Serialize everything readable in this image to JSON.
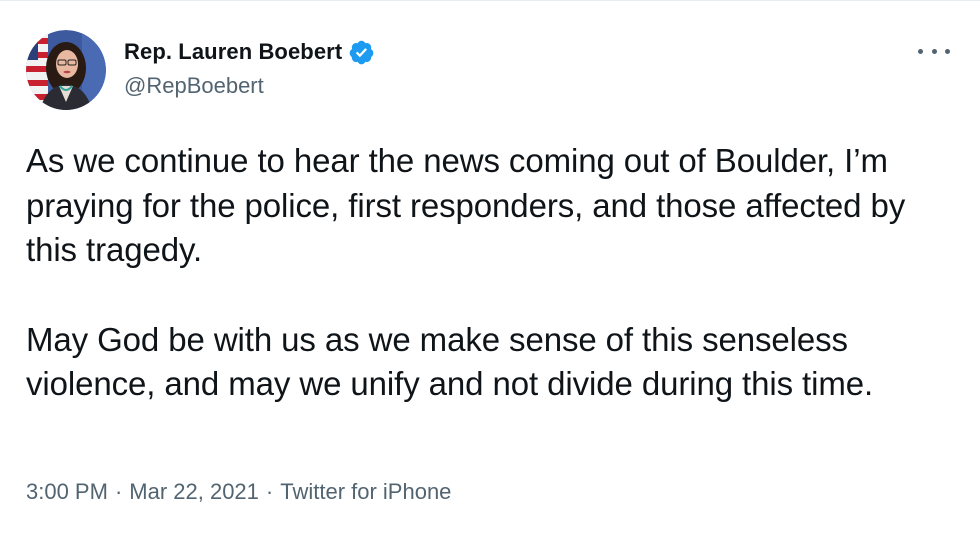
{
  "author": {
    "display_name": "Rep. Lauren Boebert",
    "handle": "@RepBoebert",
    "verified": true,
    "avatar_icon": "profile-photo"
  },
  "tweet": {
    "paragraphs": [
      "As we continue to hear the news coming out of Boulder, I’m praying for the police, first responders, and those affected by this tragedy.",
      "May God be with us as we make sense of this senseless violence, and may we unify and not divide during this time."
    ]
  },
  "meta": {
    "time": "3:00 PM",
    "separator": "·",
    "date": "Mar 22, 2021",
    "source": "Twitter for iPhone"
  },
  "icons": {
    "more": "more-options-icon",
    "verified": "verified-badge-icon"
  },
  "colors": {
    "text": "#0f1419",
    "secondary": "#536471",
    "verified_blue": "#1d9bf0",
    "border": "#e6ecf0"
  }
}
